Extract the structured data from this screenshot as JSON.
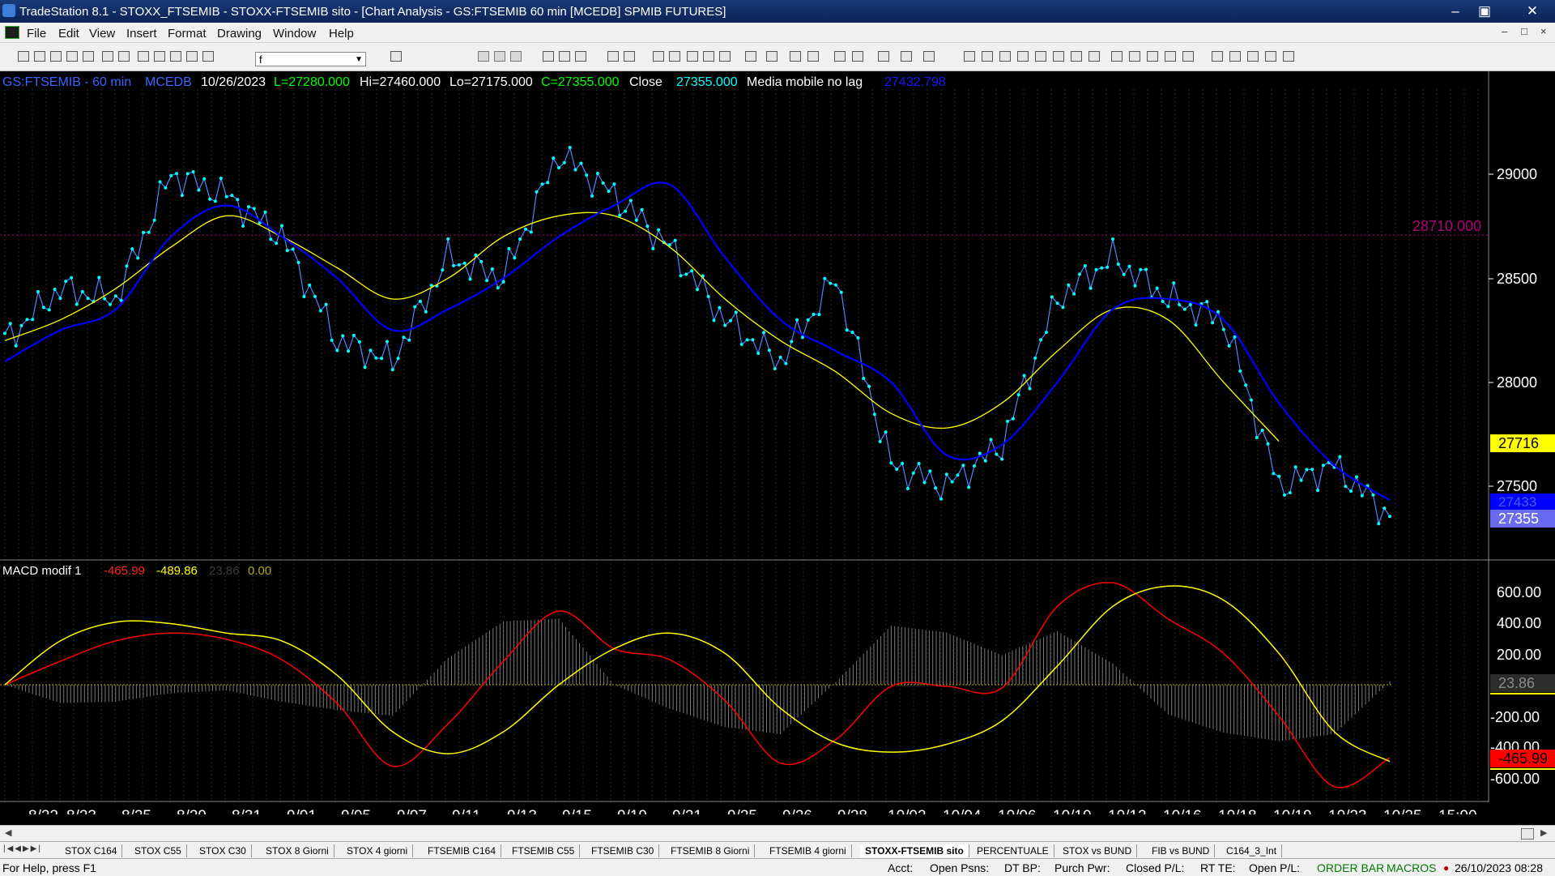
{
  "window": {
    "title": "TradeStation 8.1 - STOXX_FTSEMIB - STOXX-FTSEMIB sito - [Chart Analysis - GS:FTSEMIB  60 min  [MCEDB] SPMIB FUTURES]",
    "controls": [
      "–",
      "▣",
      "✕"
    ]
  },
  "menu": {
    "items": [
      "File",
      "Edit",
      "View",
      "Insert",
      "Format",
      "Drawing",
      "Window",
      "Help"
    ],
    "mdi_controls": [
      "–",
      "□",
      "×"
    ]
  },
  "toolbar": {
    "symbol_value": "f"
  },
  "chart": {
    "header": {
      "symbol": "GS:FTSEMIB - 60 min",
      "exchange": "MCEDB",
      "date": "10/26/2023",
      "last": "L=27280.000",
      "high": "Hi=27460.000",
      "low": "Lo=27175.000",
      "close": "C=27355.000",
      "close_label": "Close",
      "close_value": "27355.000",
      "ma_label": "Media mobile no lag",
      "ma_value": "27432.798"
    },
    "price_axis": {
      "ticks": [
        "29000",
        "28500",
        "28000",
        "27500"
      ]
    },
    "ref_line_label": "28710.000",
    "price_tags": {
      "yellow": "27716",
      "blue": "27433",
      "close": "27355"
    },
    "macd": {
      "label": "MACD modif 1",
      "value1": "-465.99",
      "value2": "-489.86",
      "value3": "23.86",
      "value4": "0.00",
      "axis_ticks": [
        "600.00",
        "400.00",
        "200.00",
        "-200.00",
        "-400.00",
        "-600.00"
      ],
      "zero_tag": "23.86",
      "value_tag": "-465.99"
    },
    "date_axis": [
      "8/22",
      "8/23",
      "8/25",
      "8/29",
      "8/31",
      "9/01",
      "9/05",
      "9/07",
      "9/11",
      "9/13",
      "9/15",
      "9/19",
      "9/21",
      "9/25",
      "9/26",
      "9/28",
      "10/02",
      "10/04",
      "10/06",
      "10/10",
      "10/12",
      "10/16",
      "10/18",
      "10/19",
      "10/23",
      "10/25",
      "15:00"
    ],
    "colors": {
      "price": "#00ffff",
      "ma_blue": "#0000ff",
      "ma_yellow": "#ffff00",
      "macd_red": "#ff0000",
      "macd_yellow": "#ffff00",
      "histogram": "#808080",
      "ref_line": "#b0007a"
    }
  },
  "chart_data": {
    "type": "line",
    "xlabel": "",
    "ylabel": "",
    "ylim": [
      27130,
      29370
    ],
    "x": [
      "8/22",
      "8/23",
      "8/25",
      "8/29",
      "8/31",
      "9/01",
      "9/05",
      "9/07",
      "9/11",
      "9/13",
      "9/15",
      "9/19",
      "9/21",
      "9/25",
      "9/26",
      "9/28",
      "10/02",
      "10/04",
      "10/06",
      "10/10",
      "10/12",
      "10/16",
      "10/18",
      "10/19",
      "10/23",
      "10/25"
    ],
    "series": [
      {
        "name": "GS:FTSEMIB",
        "values": [
          28200,
          28450,
          28400,
          29000,
          28900,
          28700,
          28200,
          28100,
          28600,
          28500,
          29100,
          28900,
          28650,
          28300,
          28100,
          28500,
          27600,
          27500,
          27700,
          28400,
          28600,
          28400,
          28300,
          27500,
          27600,
          27355
        ]
      },
      {
        "name": "Media mobile no lag",
        "values": [
          28100,
          28250,
          28350,
          28700,
          28850,
          28700,
          28500,
          28250,
          28350,
          28500,
          28700,
          28850,
          28950,
          28600,
          28300,
          28150,
          28000,
          27650,
          27700,
          28000,
          28350,
          28400,
          28300,
          27900,
          27600,
          27433
        ]
      },
      {
        "name": "",
        "values": [
          28200,
          28300,
          28450,
          28650,
          28800,
          28700,
          28550,
          28400,
          28500,
          28700,
          28800,
          28800,
          28650,
          28400,
          28200,
          28050,
          27850,
          27780,
          27900,
          28150,
          28350,
          28300,
          28000,
          27716,
          null,
          null
        ]
      },
      {
        "name": "MACD modif 1",
        "values": [
          0,
          150,
          280,
          330,
          290,
          160,
          -120,
          -520,
          -250,
          150,
          470,
          230,
          160,
          -100,
          -500,
          -350,
          -10,
          -10,
          -20,
          500,
          650,
          420,
          200,
          -200,
          -650,
          -465.99
        ]
      },
      {
        "name": "",
        "values": [
          0,
          280,
          400,
          390,
          330,
          280,
          60,
          -300,
          -440,
          -300,
          0,
          230,
          330,
          200,
          -150,
          -370,
          -430,
          -380,
          -230,
          120,
          500,
          630,
          540,
          200,
          -300,
          -489.86
        ]
      }
    ]
  }
}
